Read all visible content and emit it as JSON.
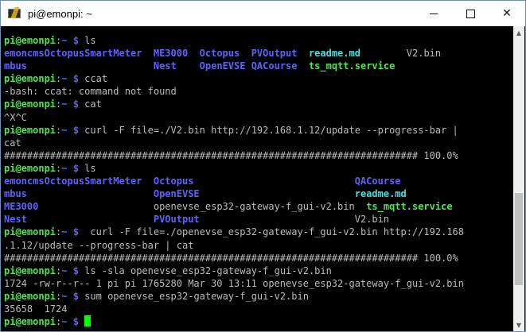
{
  "window": {
    "title": "pi@emonpi: ~",
    "controls": {
      "minimize": "minimize",
      "maximize": "maximize",
      "close": "✕"
    }
  },
  "terminal": {
    "prompt": "pi@emonpi",
    "prompt_sep": ":",
    "prompt_path": "~ $",
    "colors": {
      "prompt": "#4ce64c",
      "directory": "#6060ff",
      "executable": "#4ce64c",
      "text": "#bbbbbb",
      "cursor": "#00ff00"
    },
    "lines": [
      {
        "type": "prompt",
        "cmd": " ls"
      },
      {
        "type": "output",
        "segs": [
          {
            "t": "emoncmsOctopusSmartMeter",
            "c": "b"
          },
          {
            "t": "  "
          },
          {
            "t": "ME3000",
            "c": "b"
          },
          {
            "t": "  "
          },
          {
            "t": "Octopus",
            "c": "b"
          },
          {
            "t": "  "
          },
          {
            "t": "PVOutput",
            "c": "b"
          },
          {
            "t": "  "
          },
          {
            "t": "readme.md",
            "c": "c"
          },
          {
            "t": "        "
          },
          {
            "t": "V2.bin"
          }
        ]
      },
      {
        "type": "output",
        "segs": [
          {
            "t": "mbus",
            "c": "b"
          },
          {
            "t": "                      "
          },
          {
            "t": "Nest",
            "c": "b"
          },
          {
            "t": "    "
          },
          {
            "t": "OpenEVSE",
            "c": "b"
          },
          {
            "t": " "
          },
          {
            "t": "QACourse",
            "c": "b"
          },
          {
            "t": "  "
          },
          {
            "t": "ts_mqtt.service",
            "c": "g"
          }
        ]
      },
      {
        "type": "prompt",
        "cmd": " ccat"
      },
      {
        "type": "output",
        "segs": [
          {
            "t": "-bash: ccat: command not found"
          }
        ]
      },
      {
        "type": "prompt",
        "cmd": " cat"
      },
      {
        "type": "output",
        "segs": [
          {
            "t": "^X^C"
          }
        ]
      },
      {
        "type": "prompt",
        "cmd": " curl -F file=./V2.bin http://192.168.1.12/update --progress-bar |"
      },
      {
        "type": "output",
        "segs": [
          {
            "t": "cat"
          }
        ]
      },
      {
        "type": "output",
        "segs": [
          {
            "t": "######################################################################## 100.0%"
          }
        ]
      },
      {
        "type": "prompt",
        "cmd": " ls"
      },
      {
        "type": "output",
        "segs": [
          {
            "t": "emoncmsOctopusSmartMeter",
            "c": "b"
          },
          {
            "t": "  "
          },
          {
            "t": "Octopus",
            "c": "b"
          },
          {
            "t": "                            "
          },
          {
            "t": "QACourse",
            "c": "b"
          }
        ]
      },
      {
        "type": "output",
        "segs": [
          {
            "t": "mbus",
            "c": "b"
          },
          {
            "t": "                      "
          },
          {
            "t": "OpenEVSE",
            "c": "b"
          },
          {
            "t": "                           "
          },
          {
            "t": "readme.md",
            "c": "c"
          }
        ]
      },
      {
        "type": "output",
        "segs": [
          {
            "t": "ME3000",
            "c": "b"
          },
          {
            "t": "                    "
          },
          {
            "t": "openevse_esp32-gateway-f_gui-v2.bin"
          },
          {
            "t": "  "
          },
          {
            "t": "ts_mqtt.service",
            "c": "g"
          }
        ]
      },
      {
        "type": "output",
        "segs": [
          {
            "t": "Nest",
            "c": "b"
          },
          {
            "t": "                      "
          },
          {
            "t": "PVOutput",
            "c": "b"
          },
          {
            "t": "                           "
          },
          {
            "t": "V2.bin"
          }
        ]
      },
      {
        "type": "prompt",
        "cmd": "  curl -F file=./openevse_esp32-gateway-f_gui-v2.bin http://192.168"
      },
      {
        "type": "output",
        "segs": [
          {
            "t": ".1.12/update --progress-bar | cat"
          }
        ]
      },
      {
        "type": "output",
        "segs": [
          {
            "t": "######################################################################## 100.0%"
          }
        ]
      },
      {
        "type": "prompt",
        "cmd": " ls -sla openevse_esp32-gateway-f_gui-v2.bin"
      },
      {
        "type": "output",
        "segs": [
          {
            "t": "1724 -rw-r--r-- 1 pi pi 1765280 Mar 30 13:11 openevse_esp32-gateway-f_gui-v2.bin"
          }
        ]
      },
      {
        "type": "prompt",
        "cmd": " sum openevse_esp32-gateway-f_gui-v2.bin"
      },
      {
        "type": "output",
        "segs": [
          {
            "t": "35658  1724"
          }
        ]
      },
      {
        "type": "prompt",
        "cmd": " ",
        "cursor": true
      }
    ]
  },
  "scrollbar": {
    "up": "▲",
    "down": "▼",
    "position": 0.82
  }
}
